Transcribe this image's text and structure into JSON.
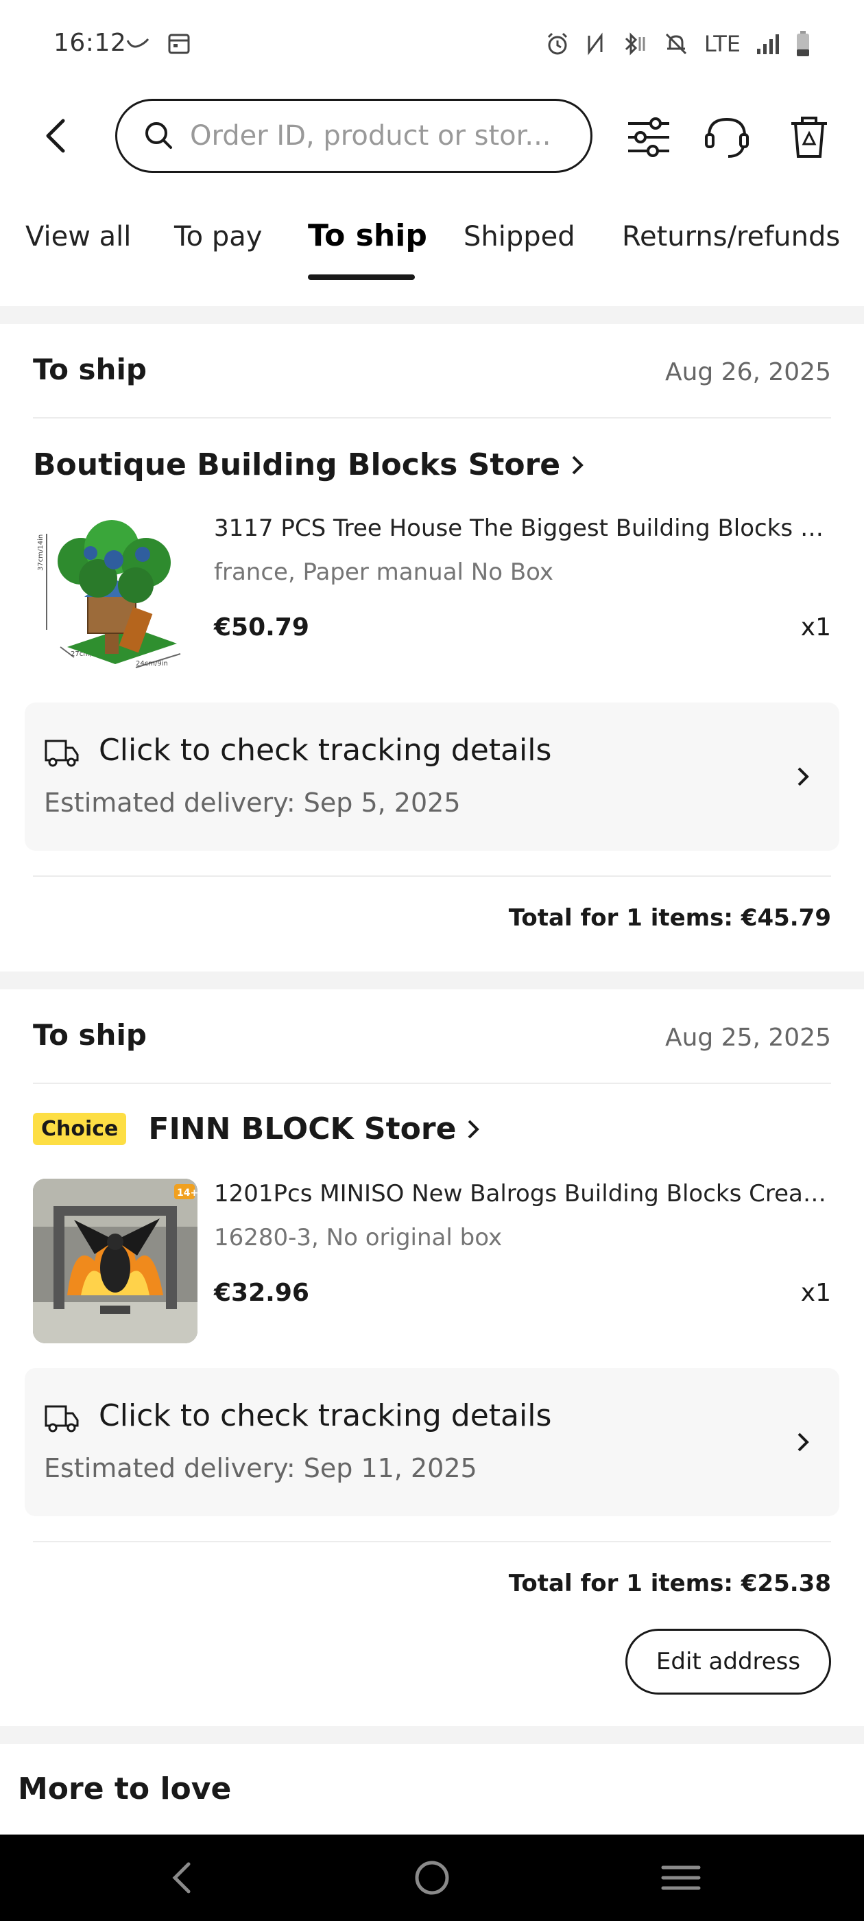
{
  "status_bar": {
    "time": "16:12",
    "network": "LTE"
  },
  "search": {
    "placeholder": "Order ID, product or stor..."
  },
  "tabs": [
    {
      "label": "View all"
    },
    {
      "label": "To pay"
    },
    {
      "label": "To ship"
    },
    {
      "label": "Shipped"
    },
    {
      "label": "Returns/refunds"
    }
  ],
  "active_tab": "To ship",
  "orders": [
    {
      "status": "To ship",
      "date": "Aug 26, 2025",
      "store": "Boutique Building Blocks Store",
      "badge": "",
      "product_title": "3117 PCS Tree House The Biggest Building Blocks Co...",
      "variant": "france, Paper manual No Box",
      "price": "€50.79",
      "qty": "x1",
      "tracking_title": "Click to check tracking details",
      "estimated_delivery": "Estimated delivery: Sep 5, 2025",
      "total": "Total for 1 items: €45.79",
      "image_labels": {
        "height": "37cm/14in",
        "width": "27cm/11in",
        "depth": "24cm/9in"
      }
    },
    {
      "status": "To ship",
      "date": "Aug 25, 2025",
      "store": "FINN BLOCK Store",
      "badge": "Choice",
      "product_title": "1201Pcs MINISO New Balrogs Building Blocks Creativ...",
      "variant": "16280-3, No original box",
      "price": "€32.96",
      "qty": "x1",
      "tracking_title": "Click to check tracking details",
      "estimated_delivery": "Estimated delivery: Sep 11, 2025",
      "total": "Total for 1 items: €25.38",
      "action_button": "Edit address",
      "image_labels": {
        "age": "14+"
      }
    }
  ],
  "more_to_love": "More to love",
  "colors": {
    "choice_badge": "#fdde44",
    "section_gap": "#f3f3f3",
    "tracking_bg": "#f7f7f7",
    "nav_bar": "#000000"
  }
}
